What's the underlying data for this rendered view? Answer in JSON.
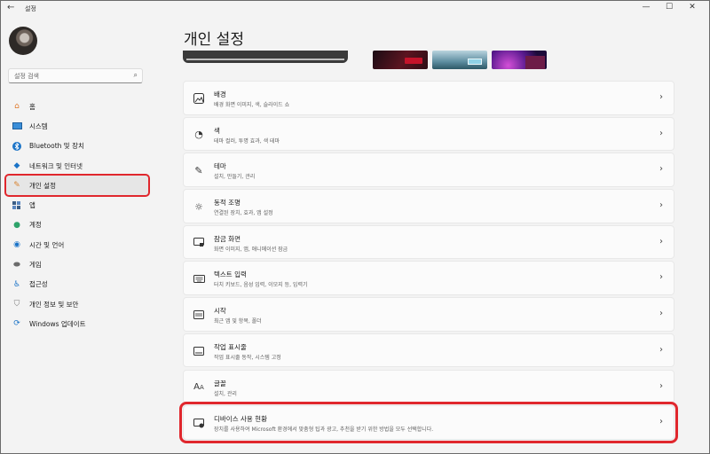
{
  "window": {
    "back_icon": "back-arrow-icon",
    "title": "설정",
    "controls": [
      "minimize",
      "maximize",
      "close"
    ]
  },
  "sidebar": {
    "search_placeholder": "설정 검색",
    "items": [
      {
        "label": "홈",
        "icon": "home-icon",
        "active": false
      },
      {
        "label": "시스템",
        "icon": "monitor-icon",
        "active": false
      },
      {
        "label": "Bluetooth 및 장치",
        "icon": "bluetooth-icon",
        "active": false
      },
      {
        "label": "네트워크 및 인터넷",
        "icon": "wifi-icon",
        "active": false
      },
      {
        "label": "개인 설정",
        "icon": "brush-icon",
        "active": true
      },
      {
        "label": "앱",
        "icon": "apps-icon",
        "active": false
      },
      {
        "label": "계정",
        "icon": "person-icon",
        "active": false
      },
      {
        "label": "시간 및 언어",
        "icon": "globe-clock-icon",
        "active": false
      },
      {
        "label": "게임",
        "icon": "gamepad-icon",
        "active": false
      },
      {
        "label": "접근성",
        "icon": "accessibility-icon",
        "active": false
      },
      {
        "label": "개인 정보 및 보안",
        "icon": "shield-icon",
        "active": false
      },
      {
        "label": "Windows 업데이트",
        "icon": "update-icon",
        "active": false
      }
    ]
  },
  "main": {
    "title": "개인 설정",
    "cards": [
      {
        "title": "배경",
        "subtitle": "배경 화면 이미지, 색, 슬라이드 쇼",
        "icon": "image-icon"
      },
      {
        "title": "색",
        "subtitle": "테마 컬러, 투명 효과, 색 테마",
        "icon": "palette-icon"
      },
      {
        "title": "테마",
        "subtitle": "설치, 만들기, 관리",
        "icon": "pen-icon"
      },
      {
        "title": "동적 조명",
        "subtitle": "연결된 장치, 효과, 앱 설정",
        "icon": "sun-icon"
      },
      {
        "title": "잠금 화면",
        "subtitle": "화면 이미지, 앱, 애니메이션 잠금",
        "icon": "lock-screen-icon"
      },
      {
        "title": "텍스트 입력",
        "subtitle": "터치 키보드, 음성 입력, 이모지 등, 입력기",
        "icon": "keyboard-icon"
      },
      {
        "title": "시작",
        "subtitle": "최근 앱 및 항목, 폴더",
        "icon": "start-icon"
      },
      {
        "title": "작업 표시줄",
        "subtitle": "작업 표시줄 동작, 시스템 고정",
        "icon": "taskbar-icon"
      },
      {
        "title": "글꼴",
        "subtitle": "설치, 관리",
        "icon": "font-icon"
      },
      {
        "title": "디바이스 사용 현황",
        "subtitle": "장치를 사용하여 Microsoft 환경에서 맞춤형 팁과 광고, 추천을 받기 위한 방법을 모두 선택합니다.",
        "icon": "device-usage-icon"
      }
    ]
  },
  "colors": {
    "highlight": "#e0272d",
    "background": "#f3f3f3",
    "card": "#fbfbfb"
  }
}
